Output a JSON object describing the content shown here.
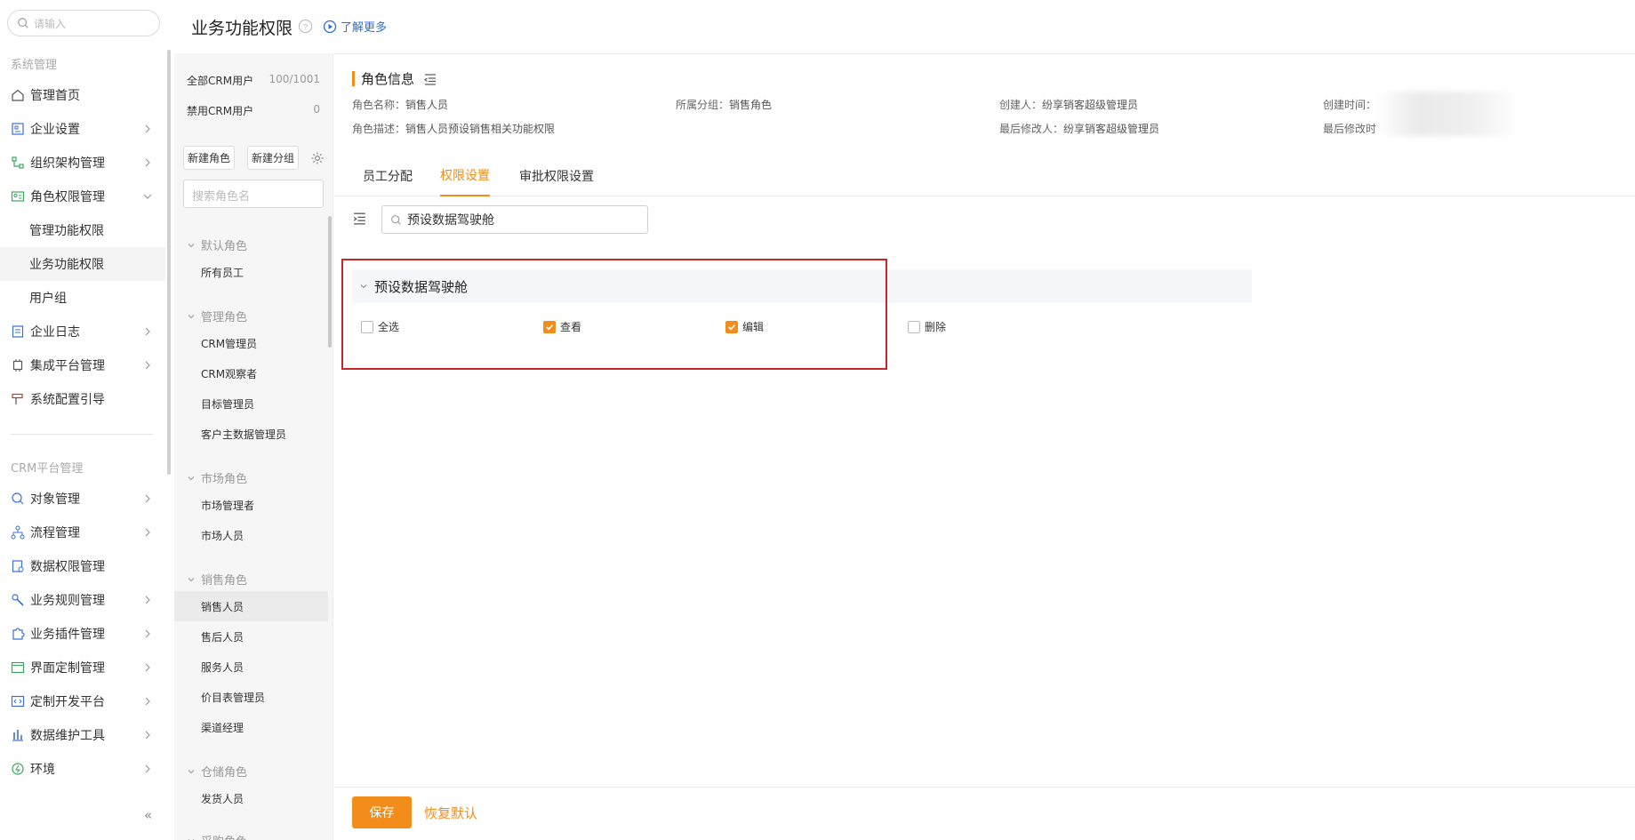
{
  "left_nav": {
    "search_placeholder": "请输入",
    "sections": {
      "system": "系统管理",
      "crm": "CRM平台管理"
    },
    "items": {
      "home": "管理首页",
      "enterprise_settings": "企业设置",
      "org_structure": "组织架构管理",
      "role_permission": "角色权限管理",
      "mgmt_function_permission": "管理功能权限",
      "business_function_permission": "业务功能权限",
      "user_group": "用户组",
      "enterprise_log": "企业日志",
      "integration_platform": "集成平台管理",
      "system_config_guide": "系统配置引导",
      "object_mgmt": "对象管理",
      "process_mgmt": "流程管理",
      "data_permission": "数据权限管理",
      "business_rules": "业务规则管理",
      "business_plugins": "业务插件管理",
      "ui_customization": "界面定制管理",
      "custom_dev_platform": "定制开发平台",
      "data_maintenance": "数据维护工具",
      "environment": "环境"
    },
    "collapse": "«"
  },
  "page": {
    "title": "业务功能权限",
    "learn_more": "了解更多"
  },
  "role_panel": {
    "all_crm_users": {
      "label": "全部CRM用户",
      "count": "100/1001"
    },
    "disabled_crm_users": {
      "label": "禁用CRM用户",
      "count": "0"
    },
    "new_role_button": "新建角色",
    "new_group_button": "新建分组",
    "search_placeholder": "搜索角色名",
    "groups": {
      "default": {
        "title": "默认角色",
        "roles": [
          "所有员工"
        ]
      },
      "management": {
        "title": "管理角色",
        "roles": [
          "CRM管理员",
          "CRM观察者",
          "目标管理员",
          "客户主数据管理员"
        ]
      },
      "market": {
        "title": "市场角色",
        "roles": [
          "市场管理者",
          "市场人员"
        ]
      },
      "sales": {
        "title": "销售角色",
        "roles": [
          "销售人员",
          "售后人员",
          "服务人员",
          "价目表管理员",
          "渠道经理"
        ]
      },
      "warehouse": {
        "title": "仓储角色",
        "roles": [
          "发货人员"
        ]
      },
      "purchase": {
        "title": "采购角色"
      }
    }
  },
  "role_info": {
    "title": "角色信息",
    "name_label": "角色名称：",
    "name_value": "销售人员",
    "group_label": "所属分组：",
    "group_value": "销售角色",
    "creator_label": "创建人：",
    "creator_value": "纷享销客超级管理员",
    "created_time_label": "创建时间：",
    "desc_label": "角色描述：",
    "desc_value": "销售人员预设销售相关功能权限",
    "modifier_label": "最后修改人：",
    "modifier_value": "纷享销客超级管理员",
    "modified_time_label": "最后修改时"
  },
  "tabs": {
    "employee_assignment": "员工分配",
    "permission_settings": "权限设置",
    "approval_permission": "审批权限设置"
  },
  "permission_search": {
    "value": "预设数据驾驶舱"
  },
  "module": {
    "title": "预设数据驾驶舱",
    "options": {
      "select_all": {
        "label": "全选",
        "checked": false
      },
      "view": {
        "label": "查看",
        "checked": true
      },
      "edit": {
        "label": "编辑",
        "checked": true
      },
      "delete": {
        "label": "删除",
        "checked": false
      }
    }
  },
  "footer": {
    "save": "保存",
    "restore_default": "恢复默认"
  },
  "colors": {
    "accent": "#f28c1a",
    "highlight_border": "#c8252c",
    "link": "#2d6fd1"
  }
}
